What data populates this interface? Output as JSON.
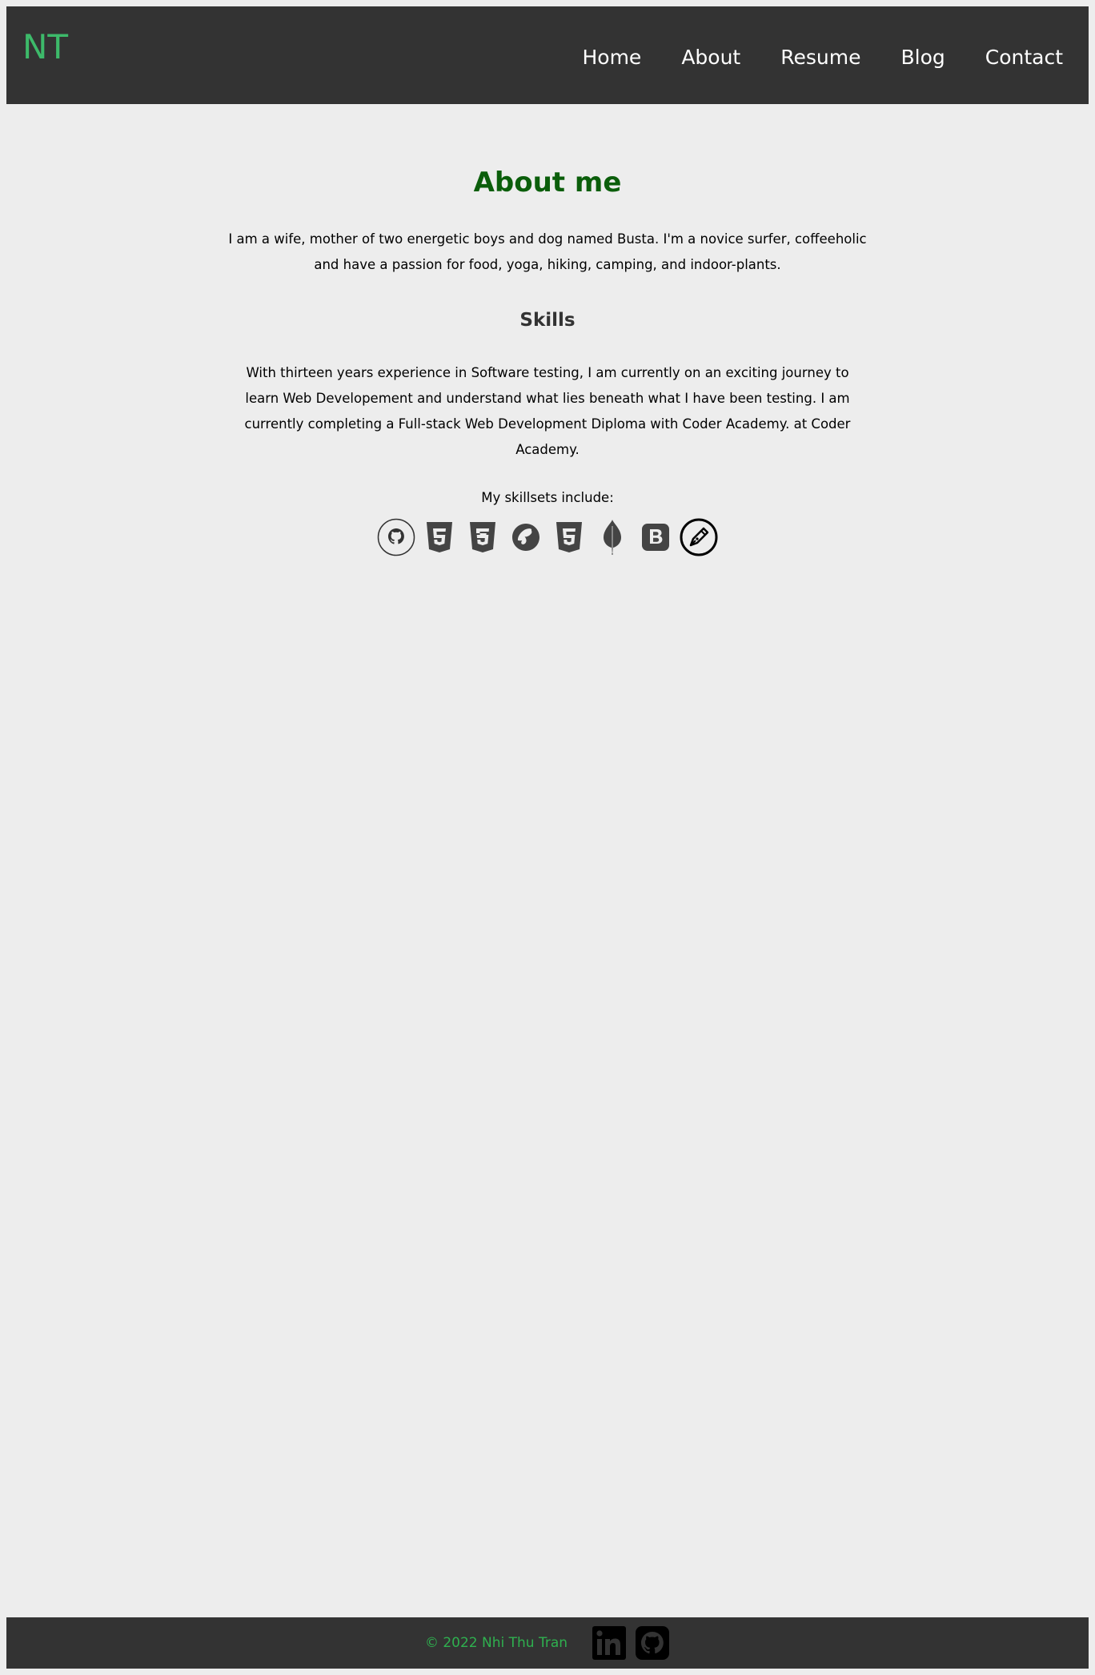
{
  "header": {
    "logo": "NT",
    "nav": [
      "Home",
      "About",
      "Resume",
      "Blog",
      "Contact"
    ]
  },
  "main": {
    "title": "About me",
    "intro": "I am a wife, mother of two energetic boys and dog named Busta. I'm a novice surfer, coffeeholic and have a passion for food, yoga, hiking, camping, and indoor-plants.",
    "skills_title": "Skills",
    "skills_text": "With thirteen years experience in Software testing, I am currently on an exciting journey to learn Web Developement and understand what lies beneath what I have been testing. I am currently completing a Full-stack Web Development Diploma with Coder Academy. at Coder Academy.",
    "skillsets_label": "My skillsets include:",
    "skill_icons": [
      "github-icon",
      "html5-icon",
      "css3-icon",
      "sass-icon",
      "html5-icon",
      "mongodb-icon",
      "bootstrap-icon",
      "pen-icon"
    ]
  },
  "footer": {
    "copyright": "© 2022 Nhi Thu Tran",
    "social_icons": [
      "linkedin-icon",
      "github-icon"
    ]
  },
  "colors": {
    "background": "#ededed",
    "header_bg": "#333333",
    "logo": "#3dba6a",
    "nav_link": "#ffffff",
    "heading_green": "#0b5e0b",
    "icon_gray": "#444444",
    "footer_text": "#2fb04f"
  }
}
